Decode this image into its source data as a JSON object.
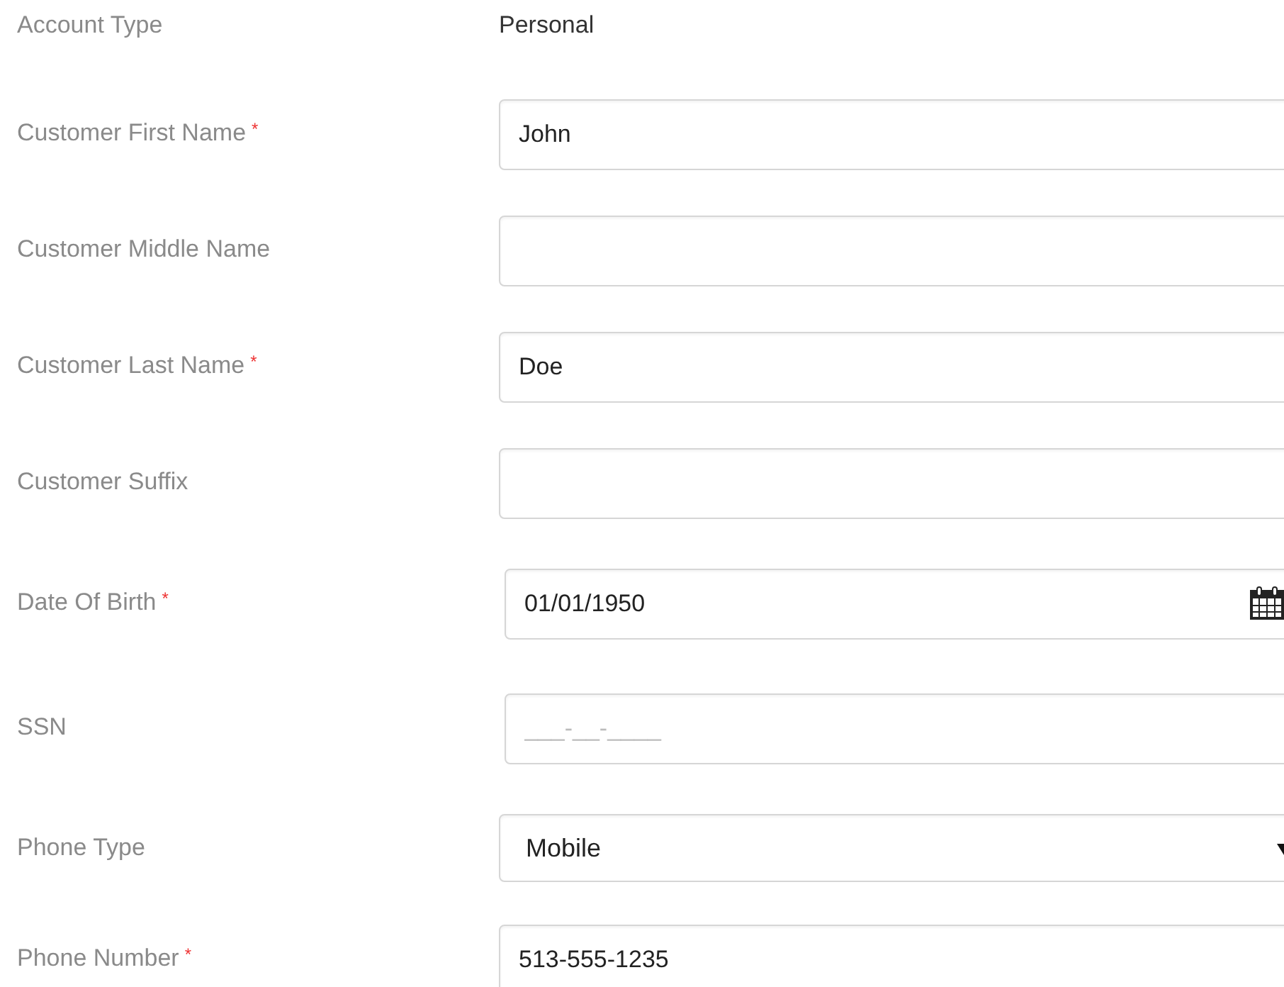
{
  "required_mark": "*",
  "fields": [
    {
      "kind": "text",
      "label": "Account Type",
      "required": false,
      "value": "Personal"
    },
    {
      "kind": "input",
      "label": "Customer First Name",
      "required": true,
      "value": "John"
    },
    {
      "kind": "input",
      "label": "Customer Middle Name",
      "required": false
    },
    {
      "kind": "input",
      "label": "Customer Last Name",
      "required": true,
      "value": "Doe"
    },
    {
      "kind": "input",
      "label": "Customer Suffix",
      "required": false
    },
    {
      "kind": "date",
      "label": "Date Of Birth",
      "required": true,
      "value": "01/01/1950"
    },
    {
      "kind": "input",
      "label": "SSN",
      "required": false,
      "placeholder": "___-__-____"
    },
    {
      "kind": "select",
      "label": "Phone Type",
      "required": false,
      "value": "Mobile"
    },
    {
      "kind": "input",
      "label": "Phone Number",
      "required": true,
      "value": "513-555-1235"
    }
  ]
}
